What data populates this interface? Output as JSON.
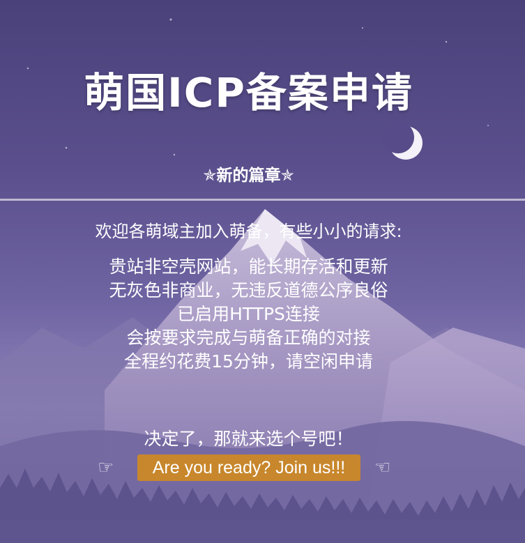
{
  "header": {
    "title": "萌国ICP备案申请",
    "subtitle": "✯新的篇章✯"
  },
  "content": {
    "intro": "欢迎各萌域主加入萌备，有些小小的请求:",
    "requests": [
      "贵站非空壳网站，能长期存活和更新",
      "无灰色非商业，无违反道德公序良俗",
      "已启用HTTPS连接",
      "会按要求完成与萌备正确的对接",
      "全程约花费15分钟，请空闲申请"
    ],
    "decision": "决定了，那就来选个号吧！"
  },
  "cta": {
    "label": "Are you ready? Join us!!!",
    "hand_left": "☞",
    "hand_right": "☜",
    "color": "#c8872c"
  },
  "icons": {
    "moon": "crescent-moon-icon",
    "hand_left": "hand-pointing-right-icon",
    "hand_right": "hand-pointing-left-icon"
  }
}
